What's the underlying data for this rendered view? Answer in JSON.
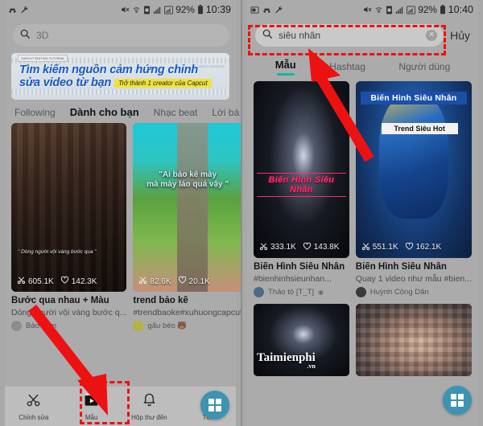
{
  "left": {
    "status": {
      "battery": "92%",
      "time": "10:39",
      "icons": [
        "bluetooth-icon",
        "wrench-icon",
        "mute-icon",
        "wifi-icon",
        "sim-icon",
        "signal-icon",
        "signal2-icon",
        "battery-icon"
      ]
    },
    "search": {
      "placeholder": "3D",
      "icon": "search-icon"
    },
    "banner": {
      "tag": "CAPCUT EDITING TUTORIAL",
      "title_line1": "Tìm kiếm nguồn cảm hứng chỉnh",
      "title_line2": "sửa video từ bạn",
      "badge": "Trở thành 1 creator của Capcut",
      "corner": "VIDEO CREATOR"
    },
    "tabs": [
      {
        "label": "Following",
        "active": false
      },
      {
        "label": "Dành cho bạn",
        "active": true
      },
      {
        "label": "Nhạc beat",
        "active": false
      },
      {
        "label": "Lời bà",
        "active": false
      }
    ],
    "cards": [
      {
        "art": "art-bar",
        "caption": "\" Dòng người vội vàng bước qua \"",
        "uses": "605.1K",
        "likes": "142.3K",
        "title": "Bước qua nhau + Màu",
        "desc": "Dòng người vội vàng bước q...",
        "author": "Bảo Lâm",
        "avatar_color": "#8c8c8c",
        "verified": false
      },
      {
        "art": "art-park",
        "caption": "\"Ai bảo kê mày\nmà mày láo quá vậy \"",
        "uses": "82.6K",
        "likes": "20.1K",
        "title": "trend bảo kê",
        "desc": "#trendbaoke#xuhuongcapcut",
        "author": "gấu béo 🐻",
        "avatar_color": "#b7b33a",
        "verified": false
      }
    ],
    "bottom_nav": [
      {
        "label": "Chỉnh sửa",
        "icon": "scissors-icon",
        "active": false
      },
      {
        "label": "Mẫu",
        "icon": "template-film-icon",
        "active": true
      },
      {
        "label": "Hộp thư đến",
        "icon": "bell-icon",
        "active": false
      },
      {
        "label": "Tôi",
        "icon": "person-icon",
        "active": false
      }
    ],
    "fab": {
      "icon": "grid-icon"
    }
  },
  "right": {
    "status": {
      "battery": "92%",
      "time": "10:40",
      "icons": [
        "window-icon",
        "bluetooth-icon",
        "wrench-icon",
        "mute-icon",
        "wifi-icon",
        "sim-icon",
        "signal-icon",
        "signal2-icon",
        "battery-icon"
      ]
    },
    "search": {
      "value": "siêu nhân",
      "icon": "search-icon",
      "clear_icon": "clear-circle-icon"
    },
    "cancel_label": "Hủy",
    "tabs": [
      {
        "label": "Mẫu",
        "active": true
      },
      {
        "label": "Hashtag",
        "active": false
      },
      {
        "label": "Người dùng",
        "active": false
      }
    ],
    "cards": [
      {
        "art": "art-dark",
        "overlay_red": "Biến Hình Siêu Nhân",
        "uses": "333.1K",
        "likes": "143.8K",
        "title": "Biến Hình Siêu Nhân",
        "desc": "#bienhinhsieunhan...",
        "author": "Thảo tò [T_T]",
        "avatar_color": "#4b6b8a",
        "verified": true
      },
      {
        "art": "art-robot",
        "overlay_blue": "Biến Hình Siêu Nhân",
        "overlay_white": "Trend Siêu Hot",
        "uses": "551.1K",
        "likes": "162.1K",
        "title": "Biến Hình Siêu Nhân",
        "desc": "Quay 1 video như mẫu #bien...",
        "author": "Huỳnh Công Dân",
        "avatar_color": "#3a3a3a",
        "verified": false
      }
    ],
    "cards_row2": [
      {
        "art": "art-dark",
        "watermark": "Taimienphi",
        "watermark_tld": ".vn"
      },
      {
        "art": "art-face",
        "watermark": "",
        "watermark_tld": ""
      }
    ],
    "fab": {
      "icon": "grid-icon"
    }
  },
  "annotations": {
    "color": "#ee1111",
    "boxes": [
      {
        "name": "search-field-highlight"
      },
      {
        "name": "template-tab-highlight"
      }
    ],
    "arrows": [
      {
        "name": "arrow-to-template-tab"
      },
      {
        "name": "arrow-to-search-field"
      }
    ]
  }
}
